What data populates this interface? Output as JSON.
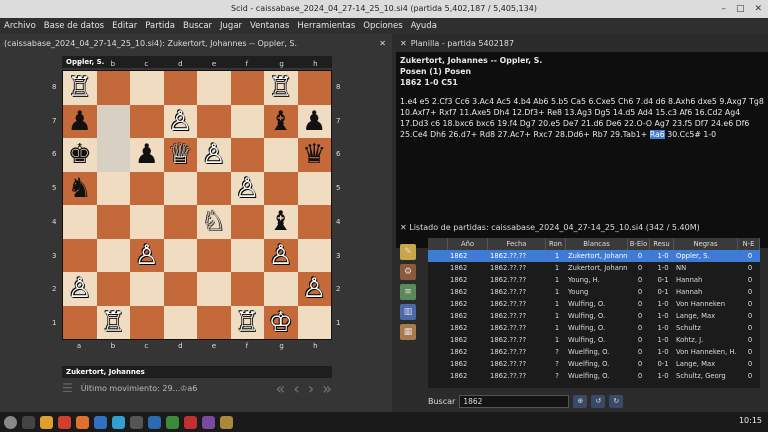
{
  "window": {
    "title": "Scid - caissabase_2024_04_27-14_25_10.si4 (partida 5,402,187 / 5,405,134)"
  },
  "menu": [
    "Archivo",
    "Base de datos",
    "Editar",
    "Partida",
    "Buscar",
    "Jugar",
    "Ventanas",
    "Herramientas",
    "Opciones",
    "Ayuda"
  ],
  "board_panel": {
    "header": "(caissabase_2024_04_27-14_25_10.si4): Zukertort, Johannes -- Oppler, S.",
    "top_player": "Oppler, S.",
    "bottom_player": "Zukertort, Johannes",
    "last_move_label": "Último movimiento: 29...♔a6",
    "files": [
      "a",
      "b",
      "c",
      "d",
      "e",
      "f",
      "g",
      "h"
    ],
    "ranks": [
      "8",
      "7",
      "6",
      "5",
      "4",
      "3",
      "2",
      "1"
    ],
    "position": [
      [
        "wR",
        "",
        "",
        "",
        "",
        "",
        "wR",
        ""
      ],
      [
        "bP",
        "",
        "",
        "wP",
        "",
        "",
        "bB",
        "bP"
      ],
      [
        "bK",
        "",
        "bP",
        "wQ",
        "wP",
        "",
        "",
        "bQ"
      ],
      [
        "bN",
        "",
        "",
        "",
        "",
        "wP",
        "",
        ""
      ],
      [
        "",
        "",
        "",
        "",
        "wN",
        "",
        "bB",
        ""
      ],
      [
        "",
        "",
        "wP",
        "",
        "",
        "",
        "wP",
        ""
      ],
      [
        "wP",
        "",
        "",
        "",
        "",
        "",
        "",
        "wP"
      ],
      [
        "",
        "wR",
        "",
        "",
        "",
        "wR",
        "wK",
        ""
      ]
    ],
    "highlight": [
      [
        1,
        1
      ],
      [
        2,
        1
      ]
    ]
  },
  "notation": {
    "panel_title": "Planilla - partida 5402187",
    "line1": "Zukertort, Johannes  --  Oppler, S.",
    "line2": "Posen (1)  Posen",
    "line3": "1862  1-0  C51",
    "moves_before": "1.e4 e5 2.Cf3 Cc6 3.Ac4 Ac5 4.b4 Ab6 5.b5 Ca5 6.Cxe5 Ch6 7.d4 d6 8.Axh6 dxe5 9.Axg7 Tg8 10.Axf7+ Rxf7 11.Axe5 Dh4 12.Df3+ Re8 13.Ag3 Dg5 14.d5 Ad4 15.c3 Af6 16.Cd2 Ag4 17.Dd3 c6 18.bxc6 bxc6 19.f4 Dg7 20.e5 De7 21.d6 De6 22.O-O Ag7 23.f5 Df7 24.e6 Df6 25.Ce4 Dh6 26.d7+ Rd8 27.Ac7+ Rxc7 28.Dd6+ Rb7 29.Tab1+ ",
    "current_move": "Ra6",
    "moves_after": " 30.Cc5# 1-0"
  },
  "game_list": {
    "panel_title": "Listado de partidas: caissabase_2024_04_27-14_25_10.si4 (342 / 5.40M)",
    "columns": [
      "Año",
      "Fecha",
      "Ron",
      "Blancas",
      "B-Elo",
      "Resu",
      "Negras",
      "N-E"
    ],
    "rows": [
      [
        "1862",
        "1862.??.??",
        "1",
        "Zukertort, Johanne",
        "0",
        "1-0",
        "Oppler, S.",
        "0"
      ],
      [
        "1862",
        "1862.??.??",
        "1",
        "Zukertort, Johanne",
        "0",
        "1-0",
        "NN",
        "0"
      ],
      [
        "1862",
        "1862.??.??",
        "1",
        "Young, H.",
        "0",
        "0-1",
        "Hannah",
        "0"
      ],
      [
        "1862",
        "1862.??.??",
        "1",
        "Young",
        "0",
        "0-1",
        "Hannah",
        "0"
      ],
      [
        "1862",
        "1862.??.??",
        "1",
        "Wulfing, O.",
        "0",
        "1-0",
        "Von Hanneken",
        "0"
      ],
      [
        "1862",
        "1862.??.??",
        "1",
        "Wulfing, O.",
        "0",
        "1-0",
        "Lange, Max",
        "0"
      ],
      [
        "1862",
        "1862.??.??",
        "1",
        "Wulfing, O.",
        "0",
        "1-0",
        "Schultz",
        "0"
      ],
      [
        "1862",
        "1862.??.??",
        "1",
        "Wulfing, O.",
        "0",
        "1-0",
        "Kohtz, J.",
        "0"
      ],
      [
        "1862",
        "1862.??.??",
        "?",
        "Wuelfing, O.",
        "0",
        "1-0",
        "Von Hanneken, H.",
        "0"
      ],
      [
        "1862",
        "1862.??.??",
        "?",
        "Wuelfing, O.",
        "0",
        "0-1",
        "Lange, Max",
        "0"
      ],
      [
        "1862",
        "1862.??.??",
        "?",
        "Wuelfing, O.",
        "0",
        "1-0",
        "Schultz, Georg",
        "0"
      ]
    ],
    "search_label": "Buscar",
    "search_value": "1862"
  },
  "taskbar": {
    "clock": "10:15"
  }
}
